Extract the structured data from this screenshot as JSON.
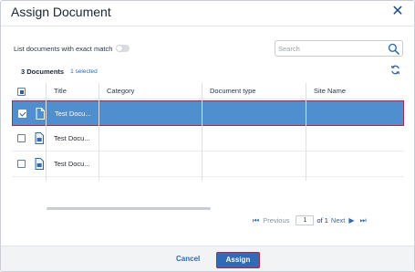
{
  "dialog": {
    "title": "Assign Document"
  },
  "filter": {
    "exact_match_label": "List documents with exact match",
    "exact_match_on": false
  },
  "search": {
    "placeholder": "Search",
    "value": ""
  },
  "summary": {
    "count": "3 Documents",
    "selected": "1 selected"
  },
  "grid": {
    "columns": [
      "Title",
      "Category",
      "Document type",
      "Site Name"
    ],
    "rows": [
      {
        "title": "Test Docu...",
        "category": "",
        "document_type": "",
        "site_name": "",
        "selected": true
      },
      {
        "title": "Test Docu...",
        "category": "",
        "document_type": "",
        "site_name": "",
        "selected": false
      },
      {
        "title": "Test Docu...",
        "category": "",
        "document_type": "",
        "site_name": "",
        "selected": false
      }
    ]
  },
  "pager": {
    "previous_label": "Previous",
    "page": "1",
    "of_label": "of 1",
    "next_label": "Next"
  },
  "footer": {
    "cancel_label": "Cancel",
    "assign_label": "Assign"
  },
  "colors": {
    "accent": "#2f6bb7",
    "selected_row": "#4f8fd0",
    "highlight_border": "#b8253a"
  },
  "icons": {
    "close": "close-icon",
    "search": "search-icon",
    "refresh": "refresh-icon",
    "document": "document-icon"
  }
}
